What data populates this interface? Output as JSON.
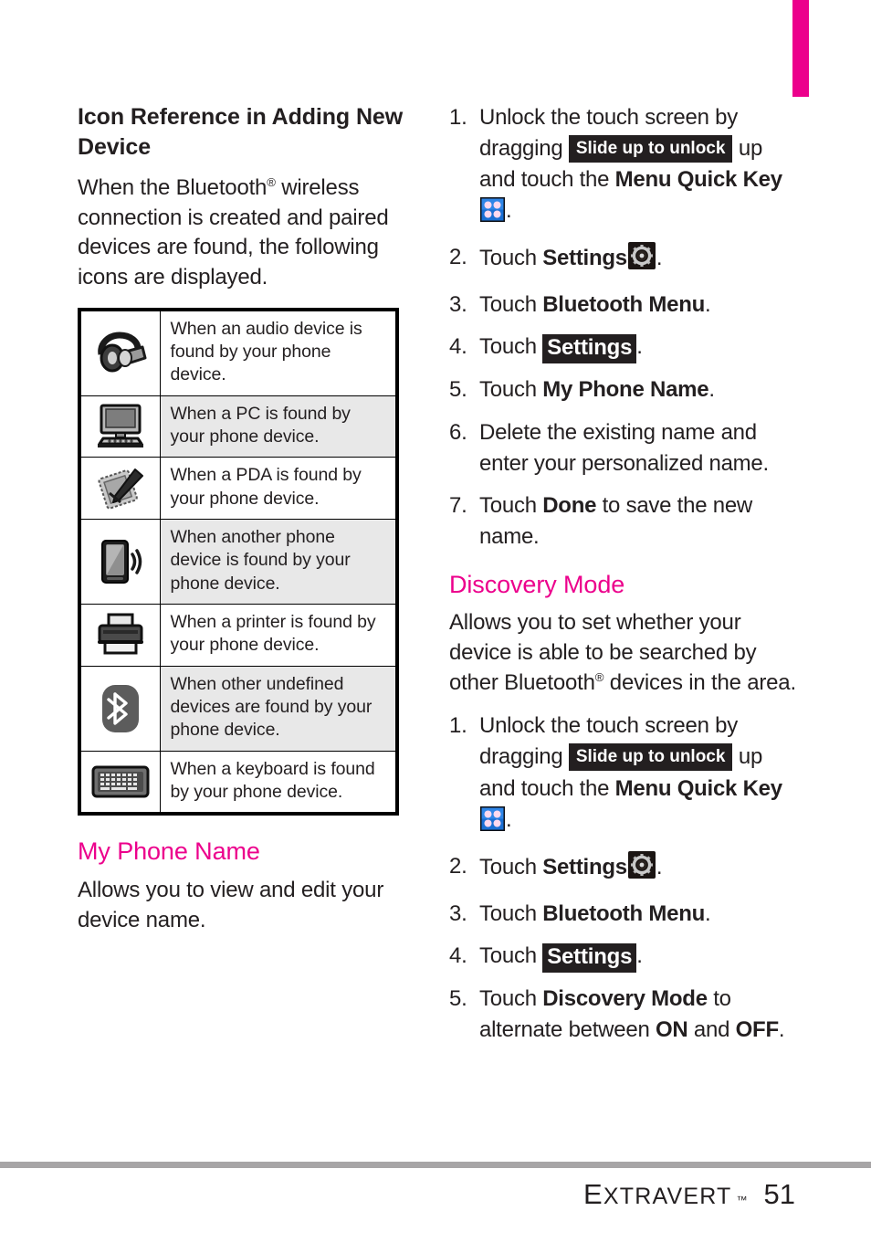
{
  "theme": {
    "accent_pink": "#ec008c",
    "text": "#231f20",
    "rule_gray": "#a7a5a6",
    "shade_row": "#e8e8e8"
  },
  "left_column": {
    "heading": "Icon Reference in Adding New Device",
    "intro_before_reg": "When the Bluetooth",
    "intro_reg": "®",
    "intro_after_reg": " wireless connection is created and paired devices are found, the following icons are displayed.",
    "table": {
      "rows": [
        {
          "icon": "headset-icon",
          "shaded": false,
          "text": "When an audio device is found by your phone device."
        },
        {
          "icon": "desktop-pc-icon",
          "shaded": true,
          "text": "When a PC is found by your phone device."
        },
        {
          "icon": "pda-stylus-icon",
          "shaded": false,
          "text": "When a PDA is found by your phone device."
        },
        {
          "icon": "mobile-phone-icon",
          "shaded": true,
          "text": "When another phone device is found by your phone device."
        },
        {
          "icon": "printer-icon",
          "shaded": false,
          "text": "When a printer is found by your phone device."
        },
        {
          "icon": "bluetooth-icon",
          "shaded": true,
          "text": "When other undefined devices are found by your phone device."
        },
        {
          "icon": "keyboard-icon",
          "shaded": false,
          "text": "When a keyboard is found by your phone device."
        }
      ]
    },
    "my_phone_name": {
      "heading": "My Phone Name",
      "body": "Allows you to view and edit your device name."
    }
  },
  "right_column": {
    "phone_name_steps": [
      {
        "num": "1.",
        "parts": [
          {
            "t": "text",
            "v": "Unlock the touch screen by dragging "
          },
          {
            "t": "chip",
            "v": "Slide up to unlock"
          },
          {
            "t": "text",
            "v": " up and touch the "
          },
          {
            "t": "bold",
            "v": "Menu Quick Key"
          },
          {
            "t": "icon",
            "v": "menu-quick-key-icon"
          },
          {
            "t": "text",
            "v": "."
          }
        ]
      },
      {
        "num": "2.",
        "parts": [
          {
            "t": "text",
            "v": "Touch "
          },
          {
            "t": "bold",
            "v": "Settings"
          },
          {
            "t": "icon",
            "v": "settings-gear-icon"
          },
          {
            "t": "text",
            "v": "."
          }
        ]
      },
      {
        "num": "3.",
        "parts": [
          {
            "t": "text",
            "v": "Touch "
          },
          {
            "t": "bold",
            "v": "Bluetooth Menu"
          },
          {
            "t": "text",
            "v": "."
          }
        ]
      },
      {
        "num": "4.",
        "parts": [
          {
            "t": "text",
            "v": "Touch "
          },
          {
            "t": "chip-settings",
            "v": "Settings"
          },
          {
            "t": "text",
            "v": "."
          }
        ]
      },
      {
        "num": "5.",
        "parts": [
          {
            "t": "text",
            "v": "Touch "
          },
          {
            "t": "bold",
            "v": "My Phone Name"
          },
          {
            "t": "text",
            "v": "."
          }
        ]
      },
      {
        "num": "6.",
        "parts": [
          {
            "t": "text",
            "v": "Delete the existing name and enter your personalized name."
          }
        ]
      },
      {
        "num": "7.",
        "parts": [
          {
            "t": "text",
            "v": "Touch "
          },
          {
            "t": "bold",
            "v": "Done"
          },
          {
            "t": "text",
            "v": " to save the new name."
          }
        ]
      }
    ],
    "discovery_mode": {
      "heading": "Discovery Mode",
      "body_before_reg": "Allows you to set whether your device is able to be searched by other Bluetooth",
      "body_reg": "®",
      "body_after_reg": " devices in the area."
    },
    "discovery_steps": [
      {
        "num": "1.",
        "parts": [
          {
            "t": "text",
            "v": "Unlock the touch screen by dragging "
          },
          {
            "t": "chip",
            "v": "Slide up to unlock"
          },
          {
            "t": "text",
            "v": " up and touch the "
          },
          {
            "t": "bold",
            "v": "Menu Quick Key"
          },
          {
            "t": "icon",
            "v": "menu-quick-key-icon"
          },
          {
            "t": "text",
            "v": "."
          }
        ]
      },
      {
        "num": "2.",
        "parts": [
          {
            "t": "text",
            "v": "Touch "
          },
          {
            "t": "bold",
            "v": "Settings"
          },
          {
            "t": "icon",
            "v": "settings-gear-icon"
          },
          {
            "t": "text",
            "v": "."
          }
        ]
      },
      {
        "num": "3.",
        "parts": [
          {
            "t": "text",
            "v": "Touch "
          },
          {
            "t": "bold",
            "v": "Bluetooth Menu"
          },
          {
            "t": "text",
            "v": "."
          }
        ]
      },
      {
        "num": "4.",
        "parts": [
          {
            "t": "text",
            "v": "Touch "
          },
          {
            "t": "chip-settings",
            "v": "Settings"
          },
          {
            "t": "text",
            "v": "."
          }
        ]
      },
      {
        "num": "5.",
        "parts": [
          {
            "t": "text",
            "v": "Touch "
          },
          {
            "t": "bold",
            "v": "Discovery Mode"
          },
          {
            "t": "text",
            "v": " to alternate between "
          },
          {
            "t": "bold",
            "v": "ON"
          },
          {
            "t": "text",
            "v": " and "
          },
          {
            "t": "bold",
            "v": "OFF"
          },
          {
            "t": "text",
            "v": "."
          }
        ]
      }
    ]
  },
  "footer": {
    "brand_cap": "E",
    "brand_rest": "XTRAVERT",
    "trademark": "™",
    "page_number": "51"
  }
}
